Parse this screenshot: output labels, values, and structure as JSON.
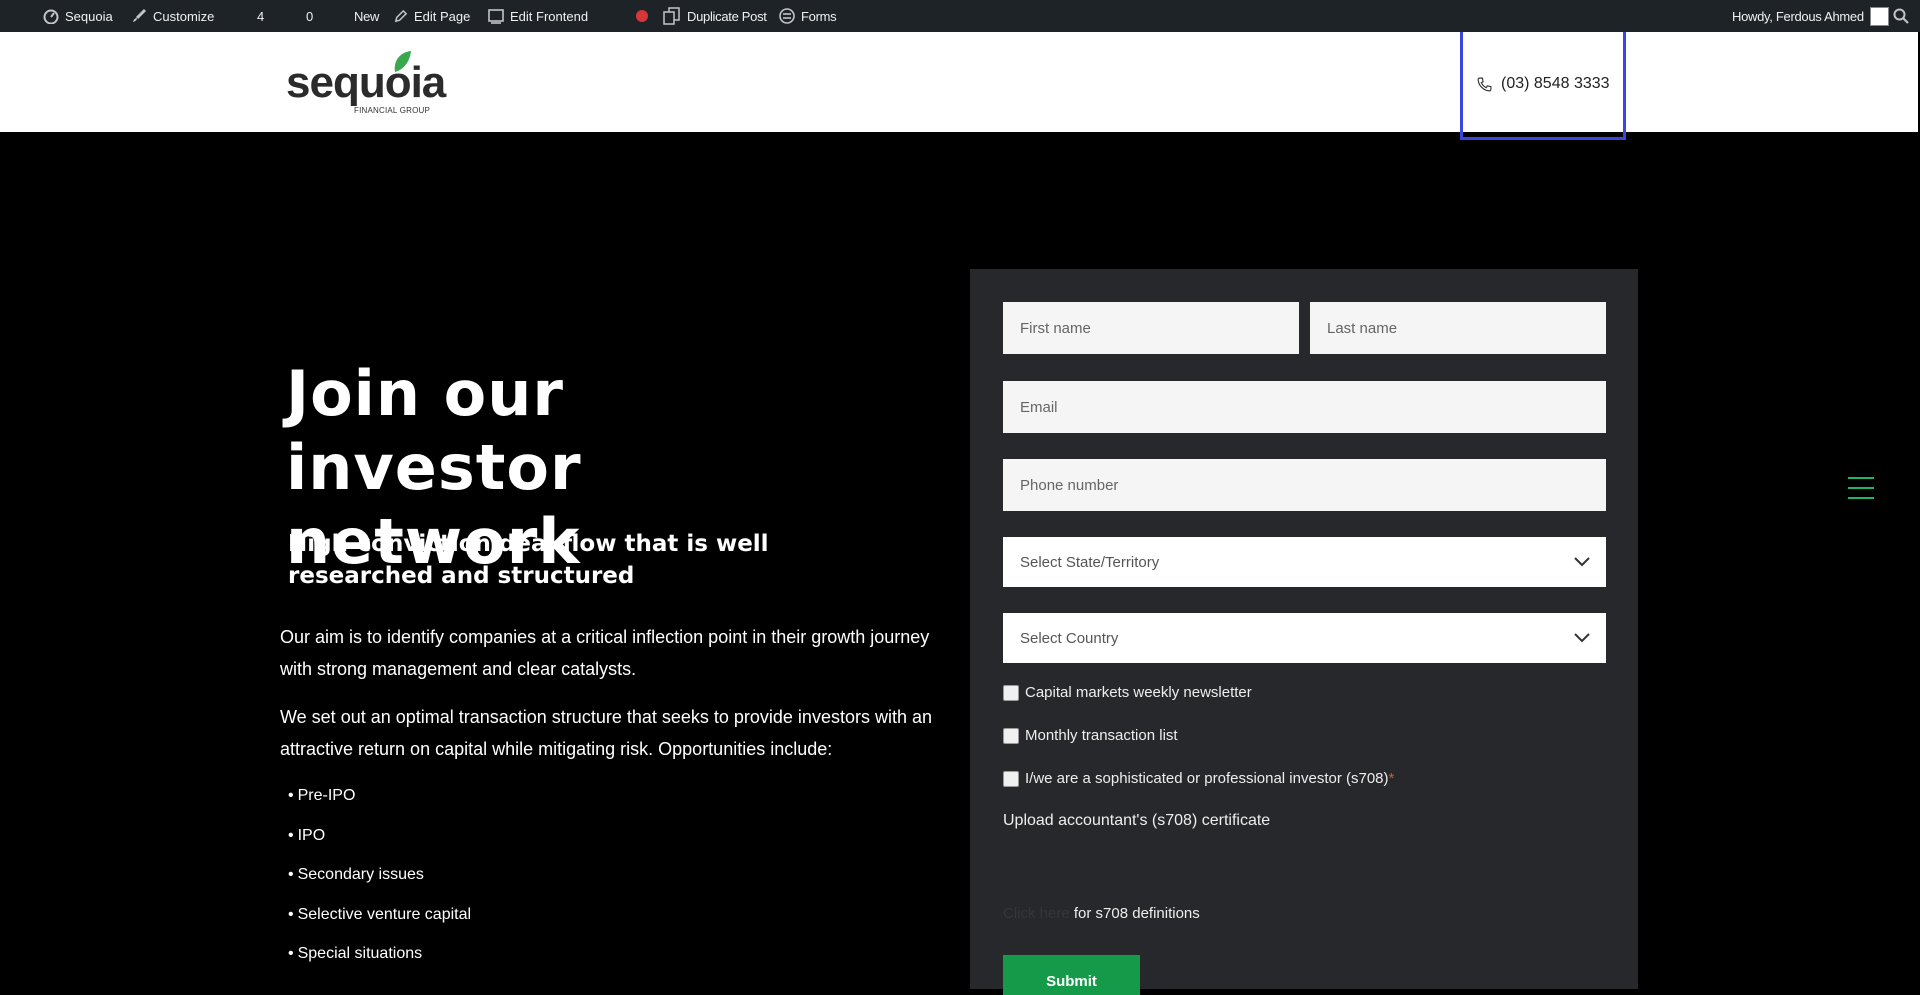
{
  "adminbar": {
    "site_name": "Sequoia",
    "customize": "Customize",
    "updates_count": "4",
    "comments_count": "0",
    "new": "New",
    "edit_page": "Edit Page",
    "edit_frontend": "Edit Frontend",
    "duplicate_post": "Duplicate Post",
    "forms": "Forms",
    "howdy": "Howdy, Ferdous Ahmed"
  },
  "header": {
    "logo_text": "sequoia",
    "logo_subtext": "FINANCIAL GROUP",
    "phone": "(03) 8548 3333"
  },
  "hero": {
    "title": "Join our investor network",
    "subtitle": "High-conviction deal flow that is well researched and structured",
    "paragraph1": "Our aim is to identify companies at a critical inflection point in their growth journey with strong management and clear catalysts.",
    "paragraph2": "We set out an optimal transaction structure that seeks to provide investors with an attractive return on capital while mitigating risk. Opportunities include:",
    "opportunities": [
      "Pre-IPO",
      "IPO",
      "Secondary issues",
      "Selective venture capital",
      "Special situations"
    ]
  },
  "form": {
    "first_name_placeholder": "First name",
    "last_name_placeholder": "Last name",
    "email_placeholder": "Email",
    "phone_placeholder": "Phone number",
    "state_select": "Select State/Territory",
    "country_select": "Select Country",
    "checkbox_newsletter": "Capital markets weekly newsletter",
    "checkbox_transactions": "Monthly transaction list",
    "checkbox_investor": "I/we are a sophisticated or professional investor (s708)",
    "required_mark": "*",
    "upload_label": "Upload accountant's (s708) certificate",
    "definitions_link": "Click here",
    "definitions_text": " for s708 definitions",
    "submit_label": "Submit"
  },
  "colors": {
    "accent_green": "#159a4a",
    "highlight_box": "#3b46e0",
    "panel_bg": "#27282b"
  }
}
